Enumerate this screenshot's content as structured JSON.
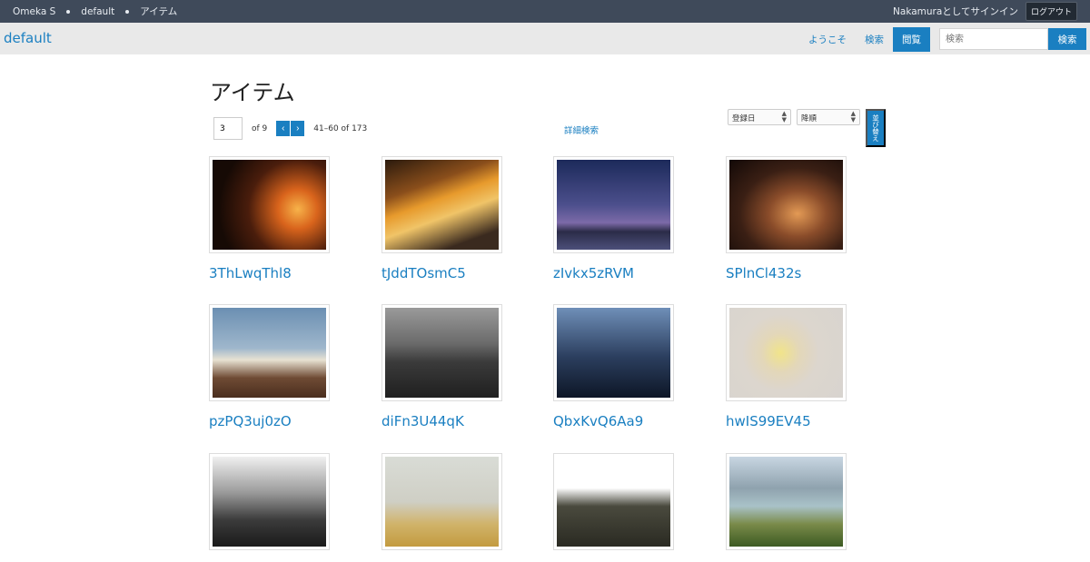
{
  "topbar": {
    "breadcrumbs": [
      "Omeka S",
      "default",
      "アイテム"
    ],
    "user_text": "Nakamuraとしてサインイン",
    "logout_label": "ログアウト"
  },
  "header": {
    "site_title": "default",
    "nav": [
      "ようこそ",
      "検索",
      "閲覧"
    ],
    "search_placeholder": "検索",
    "search_button": "検索"
  },
  "page": {
    "title": "アイテム",
    "pagination": {
      "current_page": "3",
      "of_pages": "of 9",
      "prev_icon": "‹",
      "next_icon": "›",
      "range": "41–60 of 173"
    },
    "advanced_search": "詳細検索",
    "sort": {
      "sort_by": "登録日",
      "sort_order": "降順",
      "sort_button": "並び替え"
    }
  },
  "items": [
    {
      "title": "3ThLwqThl8"
    },
    {
      "title": "tJddTOsmC5"
    },
    {
      "title": "zIvkx5zRVM"
    },
    {
      "title": "SPlnCl432s"
    },
    {
      "title": "pzPQ3uj0zO"
    },
    {
      "title": "diFn3U44qK"
    },
    {
      "title": "QbxKvQ6Aa9"
    },
    {
      "title": "hwIS99EV45"
    },
    {
      "title": ""
    },
    {
      "title": ""
    },
    {
      "title": ""
    },
    {
      "title": ""
    }
  ],
  "colors": {
    "topbar_bg": "#3f4a5a",
    "accent": "#1a7fc1",
    "header_bg": "#e9e9e9"
  }
}
